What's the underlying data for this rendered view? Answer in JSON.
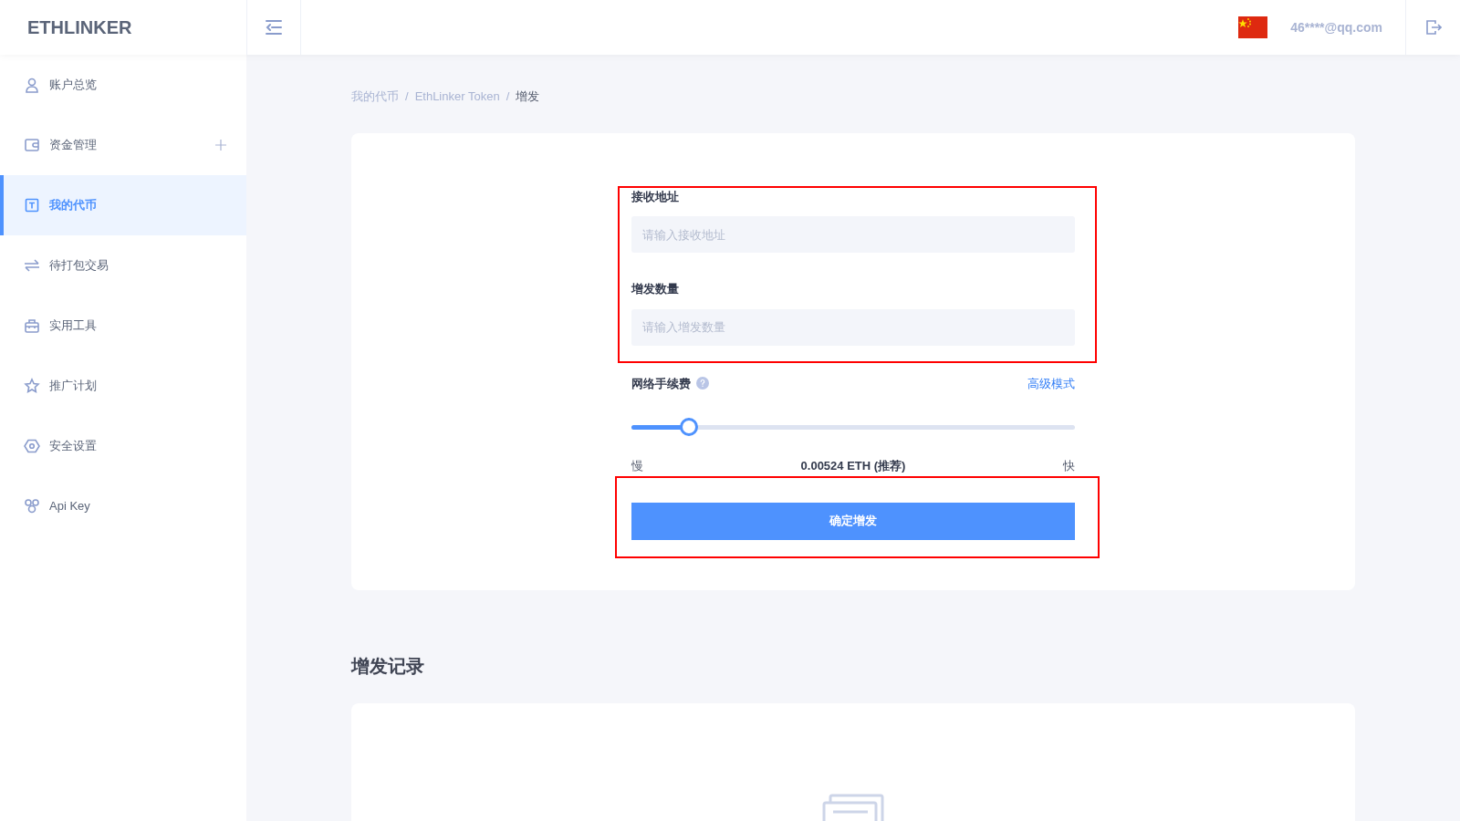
{
  "logo": "ETHLINKER",
  "header": {
    "user": "46****@qq.com"
  },
  "sidebar": {
    "items": [
      {
        "label": "账户总览",
        "selected": false,
        "expandable": false
      },
      {
        "label": "资金管理",
        "selected": false,
        "expandable": true
      },
      {
        "label": "我的代币",
        "selected": true,
        "expandable": false
      },
      {
        "label": "待打包交易",
        "selected": false,
        "expandable": false
      },
      {
        "label": "实用工具",
        "selected": false,
        "expandable": false
      },
      {
        "label": "推广计划",
        "selected": false,
        "expandable": false
      },
      {
        "label": "安全设置",
        "selected": false,
        "expandable": false
      },
      {
        "label": "Api Key",
        "selected": false,
        "expandable": false
      }
    ]
  },
  "breadcrumb": [
    {
      "label": "我的代币",
      "current": false
    },
    {
      "separator": "/"
    },
    {
      "label": "EthLinker Token",
      "current": false
    },
    {
      "separator": "/"
    },
    {
      "label": "增发",
      "current": true
    }
  ],
  "form": {
    "fields": [
      {
        "label": "接收地址",
        "placeholder": "请输入接收地址"
      },
      {
        "label": "增发数量",
        "placeholder": "请输入增发数量"
      }
    ],
    "fee": {
      "label": "网络手续费",
      "link": "高级模式",
      "level": 0.13,
      "slow": "慢",
      "fast": "快",
      "reading": "0.00524 ETH (推荐)"
    },
    "submit": "确定增发"
  },
  "records": {
    "title": "增发记录"
  }
}
